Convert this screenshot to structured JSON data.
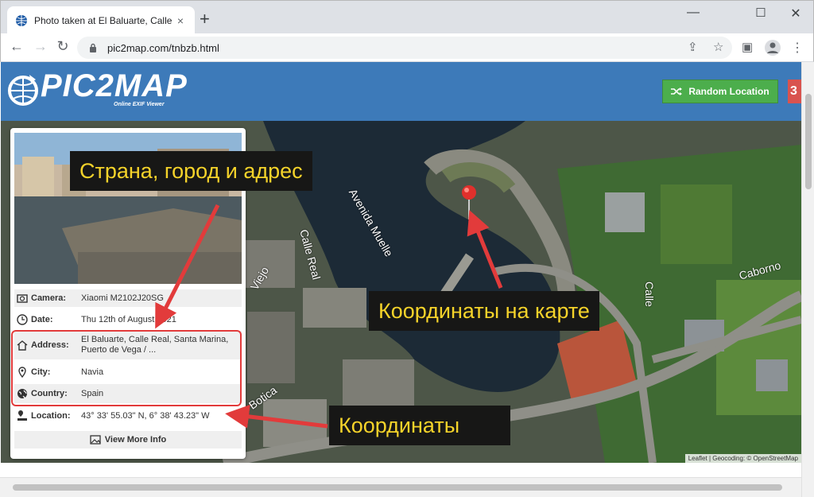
{
  "browser": {
    "tab_title": "Photo taken at El Baluarte, Calle R",
    "tab_close": "×",
    "new_tab": "+",
    "url": "pic2map.com/tnbzb.html",
    "win_min": "—",
    "win_max": "☐",
    "win_close": "✕"
  },
  "site": {
    "logo_text": "PIC2MAP",
    "logo_sub": "Online EXIF Viewer",
    "random_button": "Random Location",
    "accent_green": "#4cae4c",
    "header_blue": "#3d7ab9"
  },
  "info": {
    "rows": [
      {
        "label": "Camera:",
        "value": "Xiaomi M2102J20SG",
        "icon": "camera-icon"
      },
      {
        "label": "Date:",
        "value": "Thu 12th of August 2021",
        "icon": "clock-icon"
      },
      {
        "label": "Address:",
        "value": "El Baluarte, Calle Real, Santa Marina, Puerto de Vega / ...",
        "icon": "house-icon"
      },
      {
        "label": "City:",
        "value": "Navia",
        "icon": "map-pin-icon"
      },
      {
        "label": "Country:",
        "value": "Spain",
        "icon": "globe-icon"
      },
      {
        "label": "Location:",
        "value": "43° 33' 55.03\" N, 6° 38' 43.23\" W",
        "icon": "location-icon"
      }
    ],
    "view_more": "View More Info"
  },
  "map": {
    "streets": [
      "Avenida Muelle",
      "Calle Real",
      "Viejo",
      "Caborno",
      "Calle",
      "Botica"
    ],
    "attribution": "Leaflet | Geocoding: © OpenStreetMap"
  },
  "annotations": {
    "callout_address": "Страна, город и адрес",
    "callout_map": "Координаты на карте",
    "callout_coords": "Координаты",
    "arrow_color": "#e23b3b"
  }
}
